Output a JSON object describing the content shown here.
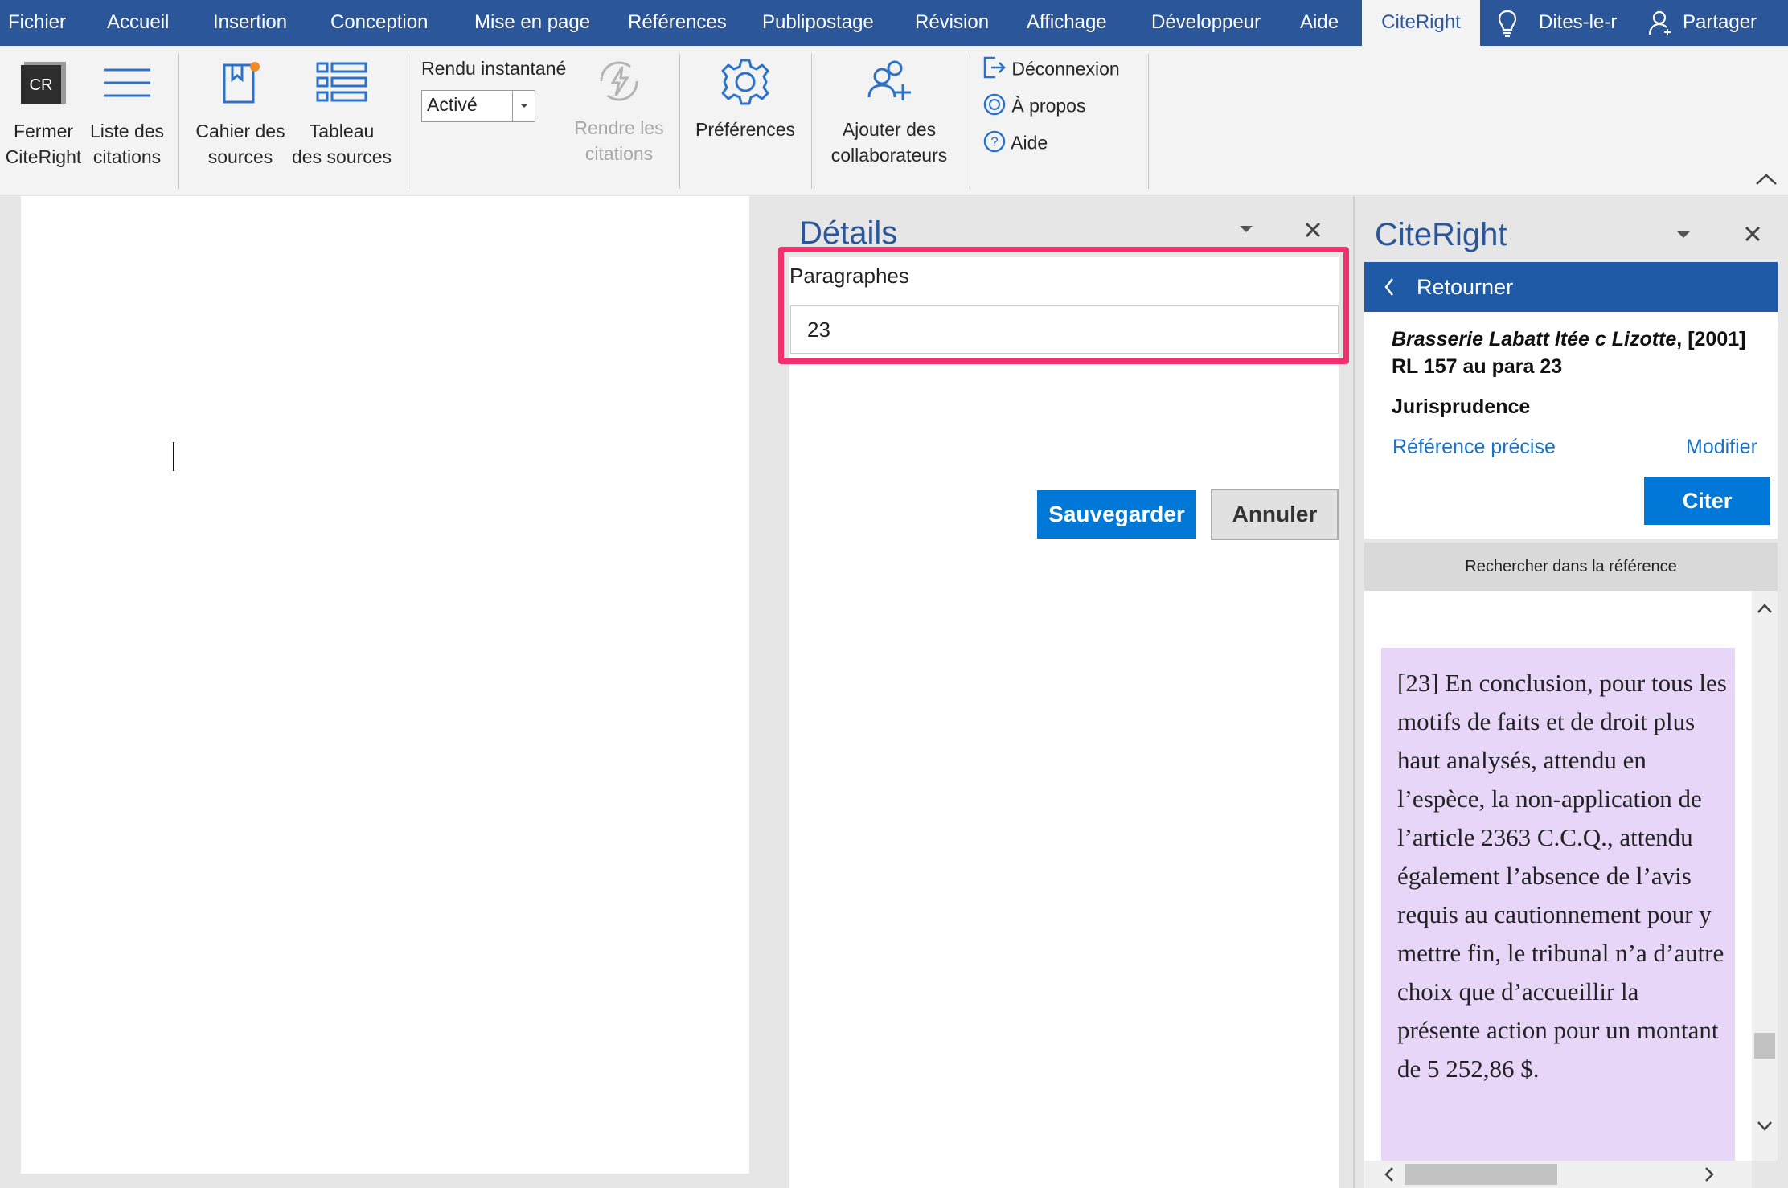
{
  "menu": {
    "tabs": [
      "Fichier",
      "Accueil",
      "Insertion",
      "Conception",
      "Mise en page",
      "Références",
      "Publipostage",
      "Révision",
      "Affichage",
      "Développeur",
      "Aide"
    ],
    "active_tab": "CiteRight",
    "tell_me": "Dites-le-r",
    "share": "Partager"
  },
  "ribbon": {
    "close_line1": "Fermer",
    "close_line2": "CiteRight",
    "list_line1": "Liste des",
    "list_line2": "citations",
    "notebook_line1": "Cahier des",
    "notebook_line2": "sources",
    "table_line1": "Tableau",
    "table_line2": "des sources",
    "instant_label": "Rendu instantané",
    "instant_value": "Activé",
    "render_line1": "Rendre les",
    "render_line2": "citations",
    "preferences": "Préférences",
    "collab_line1": "Ajouter des",
    "collab_line2": "collaborateurs",
    "logout": "Déconnexion",
    "about": "À propos",
    "help": "Aide",
    "logo_text": "CR"
  },
  "details": {
    "title": "Détails",
    "field_label": "Paragraphes",
    "field_value": "23",
    "save": "Sauvegarder",
    "cancel": "Annuler"
  },
  "citeright": {
    "title": "CiteRight",
    "back": "Retourner",
    "citation_italic": "Brasserie Labatt ltée c Lizotte",
    "citation_rest": ", [2001] RL 157 au para 23",
    "type": "Jurisprudence",
    "precise_ref": "Référence précise",
    "modify": "Modifier",
    "cite": "Citer",
    "search": "Rechercher dans la référence",
    "paragraph": "[23]     En conclusion, pour tous les motifs de faits et de droit plus haut analysés, attendu en l’espèce, la non-application de l’article 2363 C.C.Q., attendu également l’absence de l’avis requis au cautionnement pour y mettre fin, le tribunal n’a d’autre choix que d’accueillir la présente action pour un montant de 5 252,86 $."
  }
}
